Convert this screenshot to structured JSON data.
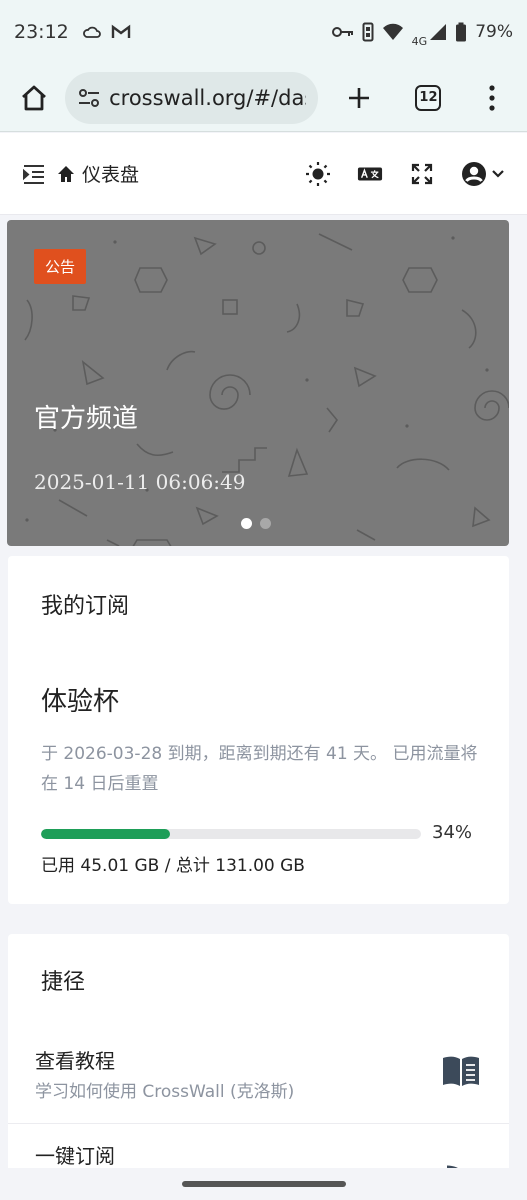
{
  "status_bar": {
    "time": "23:12",
    "network": "4G",
    "battery": "79%"
  },
  "browser": {
    "url": "crosswall.org/#/das",
    "tab_count": "12"
  },
  "header": {
    "page_title": "仪表盘"
  },
  "banner": {
    "badge": "公告",
    "title": "官方频道",
    "date": "2025-01-11 06:06:49",
    "slide_count": 2,
    "active_slide": 0
  },
  "subscription": {
    "card_title": "我的订阅",
    "plan_name": "体验杯",
    "expire_text": "于 2026-03-28 到期，距离到期还有 41 天。 已用流量将在 14 日后重置",
    "progress_percent": 34,
    "percent_label": "34%",
    "usage_text": "已用 45.01 GB / 总计 131.00 GB"
  },
  "shortcuts": {
    "card_title": "捷径",
    "items": [
      {
        "title": "查看教程",
        "desc": "学习如何使用 CrossWall (克洛斯)",
        "icon": "book-icon"
      },
      {
        "title": "一键订阅",
        "desc": "",
        "icon": "rss-icon"
      }
    ]
  },
  "colors": {
    "badge": "#e0501e",
    "progress": "#1e9e58",
    "banner_bg": "#7a7a7a"
  }
}
